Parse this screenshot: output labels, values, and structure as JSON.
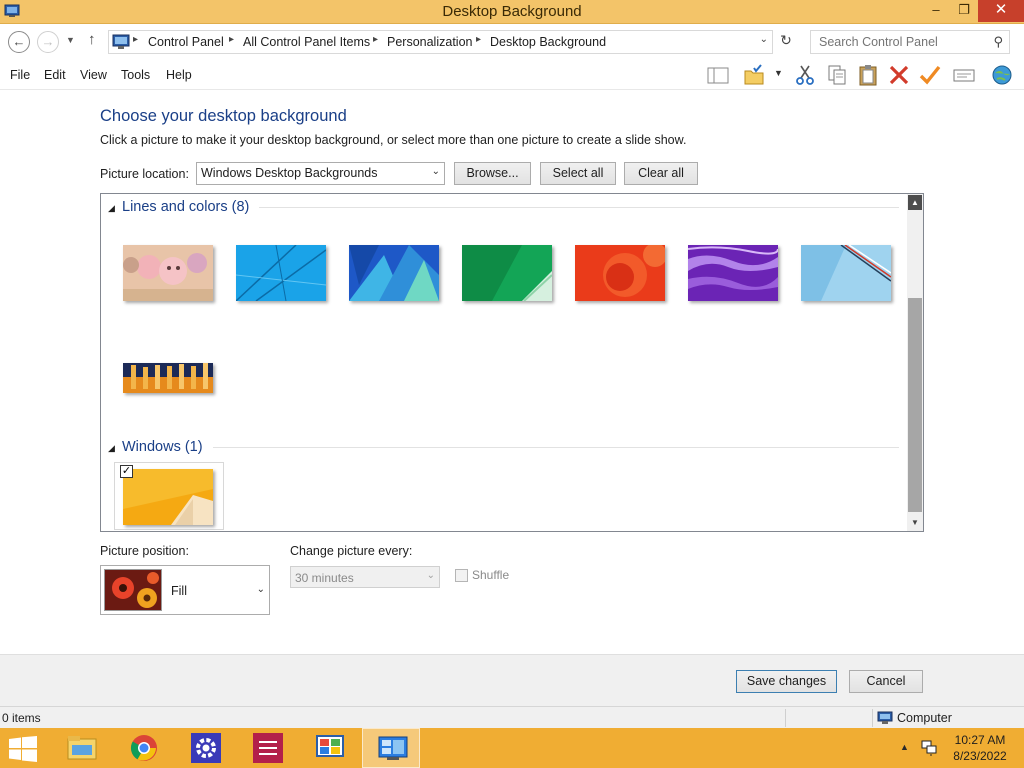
{
  "window": {
    "title": "Desktop Background",
    "minimize_symbol": "–",
    "maximize_symbol": "❐",
    "close_symbol": "✕"
  },
  "address": {
    "breadcrumbs": [
      "Control Panel",
      "All Control Panel Items",
      "Personalization",
      "Desktop Background"
    ],
    "search_placeholder": "Search Control Panel"
  },
  "menu": {
    "items": [
      "File",
      "Edit",
      "View",
      "Tools",
      "Help"
    ]
  },
  "toolbar": {
    "icons": [
      "layout-pane-icon",
      "folder-check-icon",
      "cut-icon",
      "copy-icon",
      "paste-icon",
      "delete-icon",
      "checkmark-icon",
      "properties-icon",
      "globe-icon"
    ]
  },
  "main": {
    "heading": "Choose your desktop background",
    "subheading": "Click a picture to make it your desktop background, or select more than one picture to create a slide show.",
    "location_label": "Picture location:",
    "location_value": "Windows Desktop Backgrounds",
    "browse_label": "Browse...",
    "select_all_label": "Select all",
    "clear_all_label": "Clear all"
  },
  "gallery": {
    "groups": [
      {
        "label": "Lines and colors (8)",
        "count": 8
      },
      {
        "label": "Windows (1)",
        "count": 1,
        "selected": true
      }
    ]
  },
  "options": {
    "position_label": "Picture position:",
    "position_value": "Fill",
    "interval_label": "Change picture every:",
    "interval_value": "30 minutes",
    "shuffle_label": "Shuffle",
    "shuffle_checked": false
  },
  "footer": {
    "save_label": "Save changes",
    "cancel_label": "Cancel"
  },
  "status": {
    "items_text": "0 items",
    "location_text": "Computer"
  },
  "taskbar": {
    "apps": [
      "file-explorer-icon",
      "chrome-icon",
      "settings-icon",
      "tasks-app-icon",
      "control-panel-icon",
      "desktop-background-icon"
    ],
    "time": "10:27 AM",
    "date": "8/23/2022"
  },
  "colors": {
    "titlebar": "#f3c469",
    "taskbar": "#f0ad33",
    "heading": "#1a3f87",
    "close_button": "#c7402b"
  }
}
